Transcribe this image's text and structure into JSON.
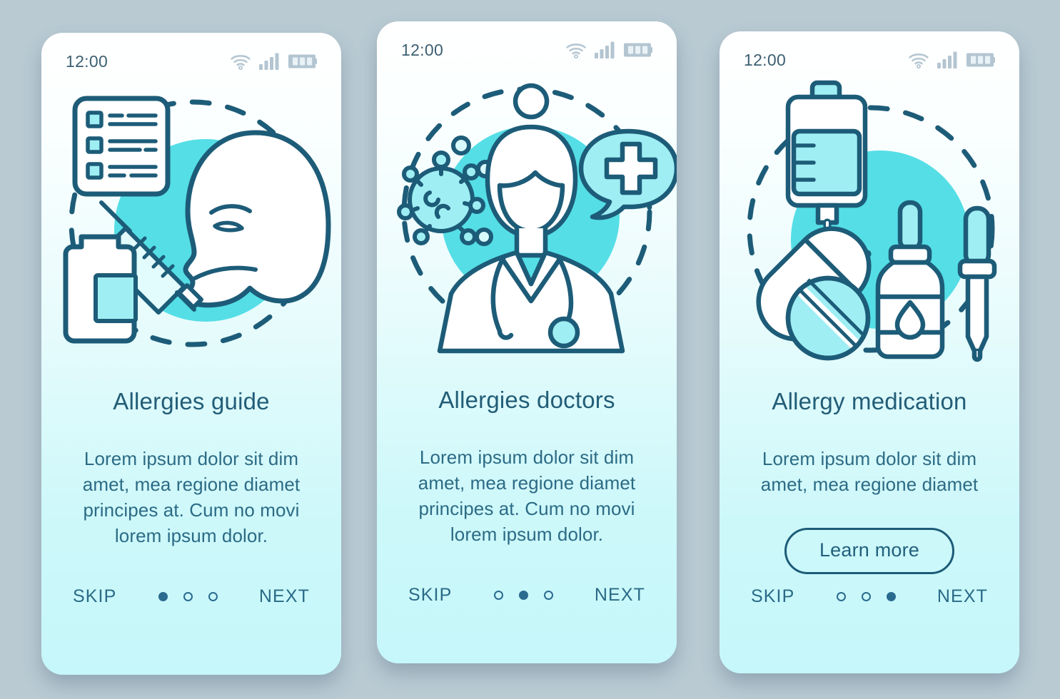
{
  "background_color": "#b9cad3",
  "theme": {
    "accent_turquoise": "#55dee6",
    "stroke_dark_teal": "#1d5c78",
    "title_color": "#225d77",
    "body_color": "#2c6b85",
    "nav_color": "#2a6a87",
    "status_icon_color": "#b3c5d1",
    "card_gradient_top": "#ffffff",
    "card_gradient_bottom": "#c6f7fa"
  },
  "statusbar": {
    "time": "12:00",
    "icons": [
      "wifi-icon",
      "cellular-signal-icon",
      "battery-icon"
    ]
  },
  "screens": [
    {
      "id": "screen-allergies-guide",
      "illustration": "allergy-test-checklist-face-syringe-icon",
      "title": "Allergies guide",
      "description": "Lorem ipsum dolor sit dim amet, mea regione diamet principes at. Cum no movi lorem ipsum dolor.",
      "cta": null,
      "skip_label": "SKIP",
      "next_label": "NEXT",
      "dots": [
        "on",
        "off",
        "off"
      ]
    },
    {
      "id": "screen-allergies-doctors",
      "illustration": "doctor-virus-medical-cross-bubble-icon",
      "title": "Allergies doctors",
      "description": "Lorem ipsum dolor sit dim amet, mea regione diamet principes at. Cum no movi lorem ipsum dolor.",
      "cta": null,
      "skip_label": "SKIP",
      "next_label": "NEXT",
      "dots": [
        "off",
        "on",
        "off"
      ]
    },
    {
      "id": "screen-allergy-medication",
      "illustration": "iv-bag-pills-dropper-bottle-pipette-icon",
      "title": "Allergy medication",
      "description": "Lorem ipsum dolor sit dim amet, mea regione diamet",
      "cta": "Learn more",
      "skip_label": "SKIP",
      "next_label": "NEXT",
      "dots": [
        "off",
        "off",
        "on"
      ]
    }
  ]
}
